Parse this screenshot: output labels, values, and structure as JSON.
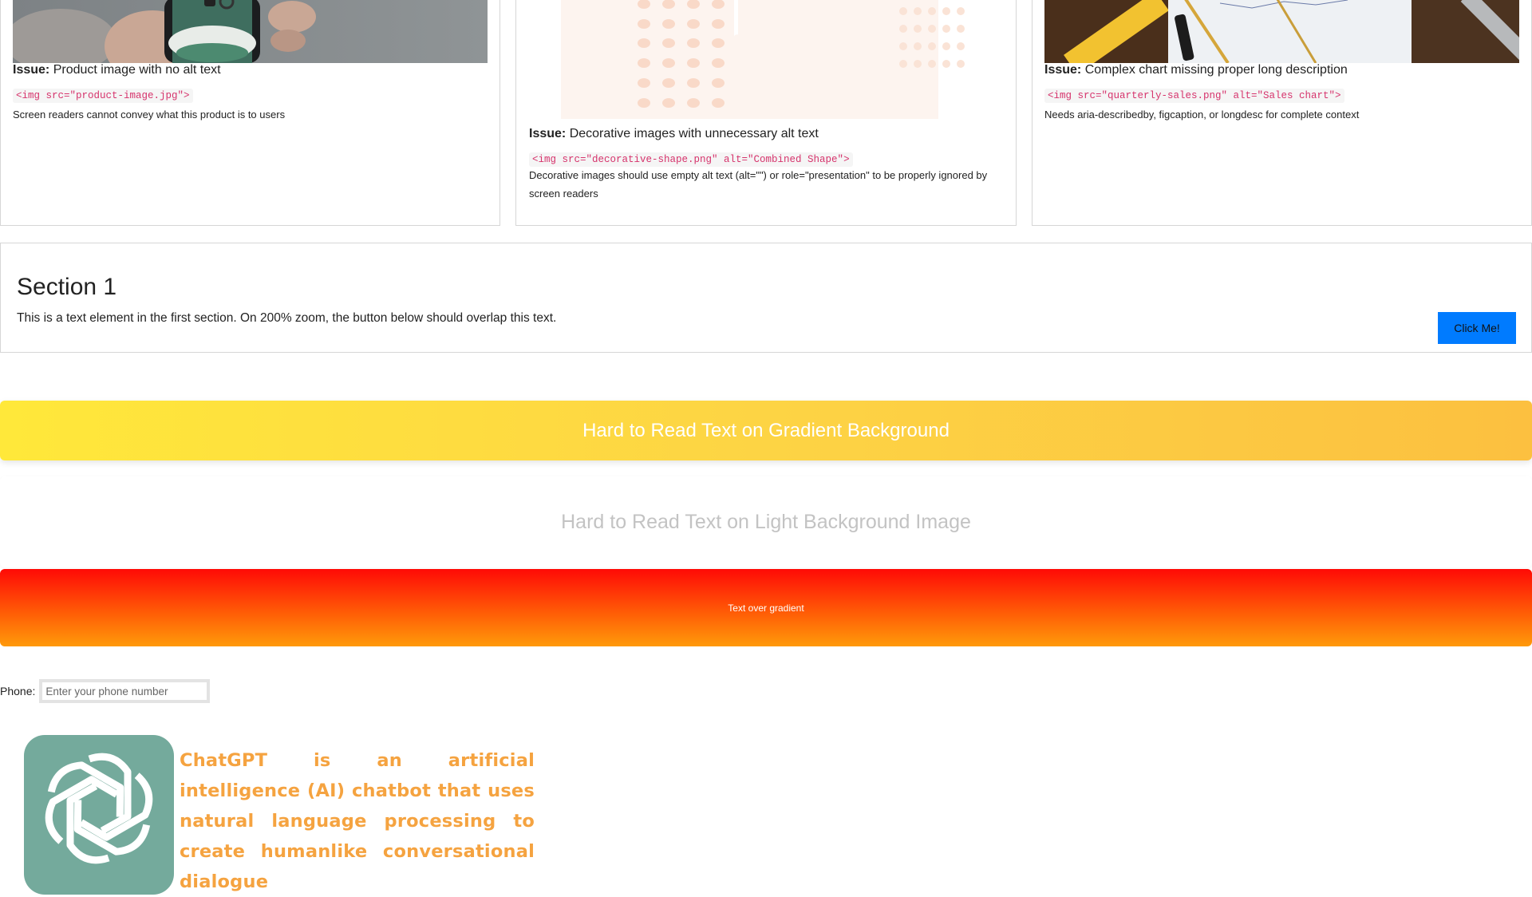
{
  "cards": [
    {
      "issue_label": "Issue:",
      "issue_text": "Product image with no alt text",
      "code": "<img src=\"product-image.jpg\">",
      "description": "Screen readers cannot convey what this product is to users"
    },
    {
      "issue_label": "Issue:",
      "issue_text": "Decorative images with unnecessary alt text",
      "code": "<img src=\"decorative-shape.png\" alt=\"Combined Shape\">",
      "description": "Decorative images should use empty alt text (alt=\"\") or role=\"presentation\" to be properly ignored by screen readers"
    },
    {
      "issue_label": "Issue:",
      "issue_text": "Complex chart missing proper long description",
      "code": "<img src=\"quarterly-sales.png\" alt=\"Sales chart\">",
      "description": "Needs aria-describedby, figcaption, or longdesc for complete context"
    }
  ],
  "section1": {
    "title": "Section 1",
    "text": "This is a text element in the first section. On 200% zoom, the button below should overlap this text.",
    "button_label": "Click Me!"
  },
  "banners": {
    "gradient_text": "Hard to Read Text on Gradient Background",
    "light_text": "Hard to Read Text on Light Background Image",
    "red_text": "Text over gradient"
  },
  "phone": {
    "label": "Phone:",
    "placeholder": "Enter your phone number"
  },
  "chatgpt": {
    "text": "ChatGPT is an artificial intelligence (AI) chatbot that uses natural language processing to create humanlike conversational dialogue"
  },
  "colors": {
    "button_blue": "#007bff",
    "code_pink": "#d6336c",
    "gpt_green": "#74aa9c",
    "gpt_orange": "#f5a340"
  }
}
